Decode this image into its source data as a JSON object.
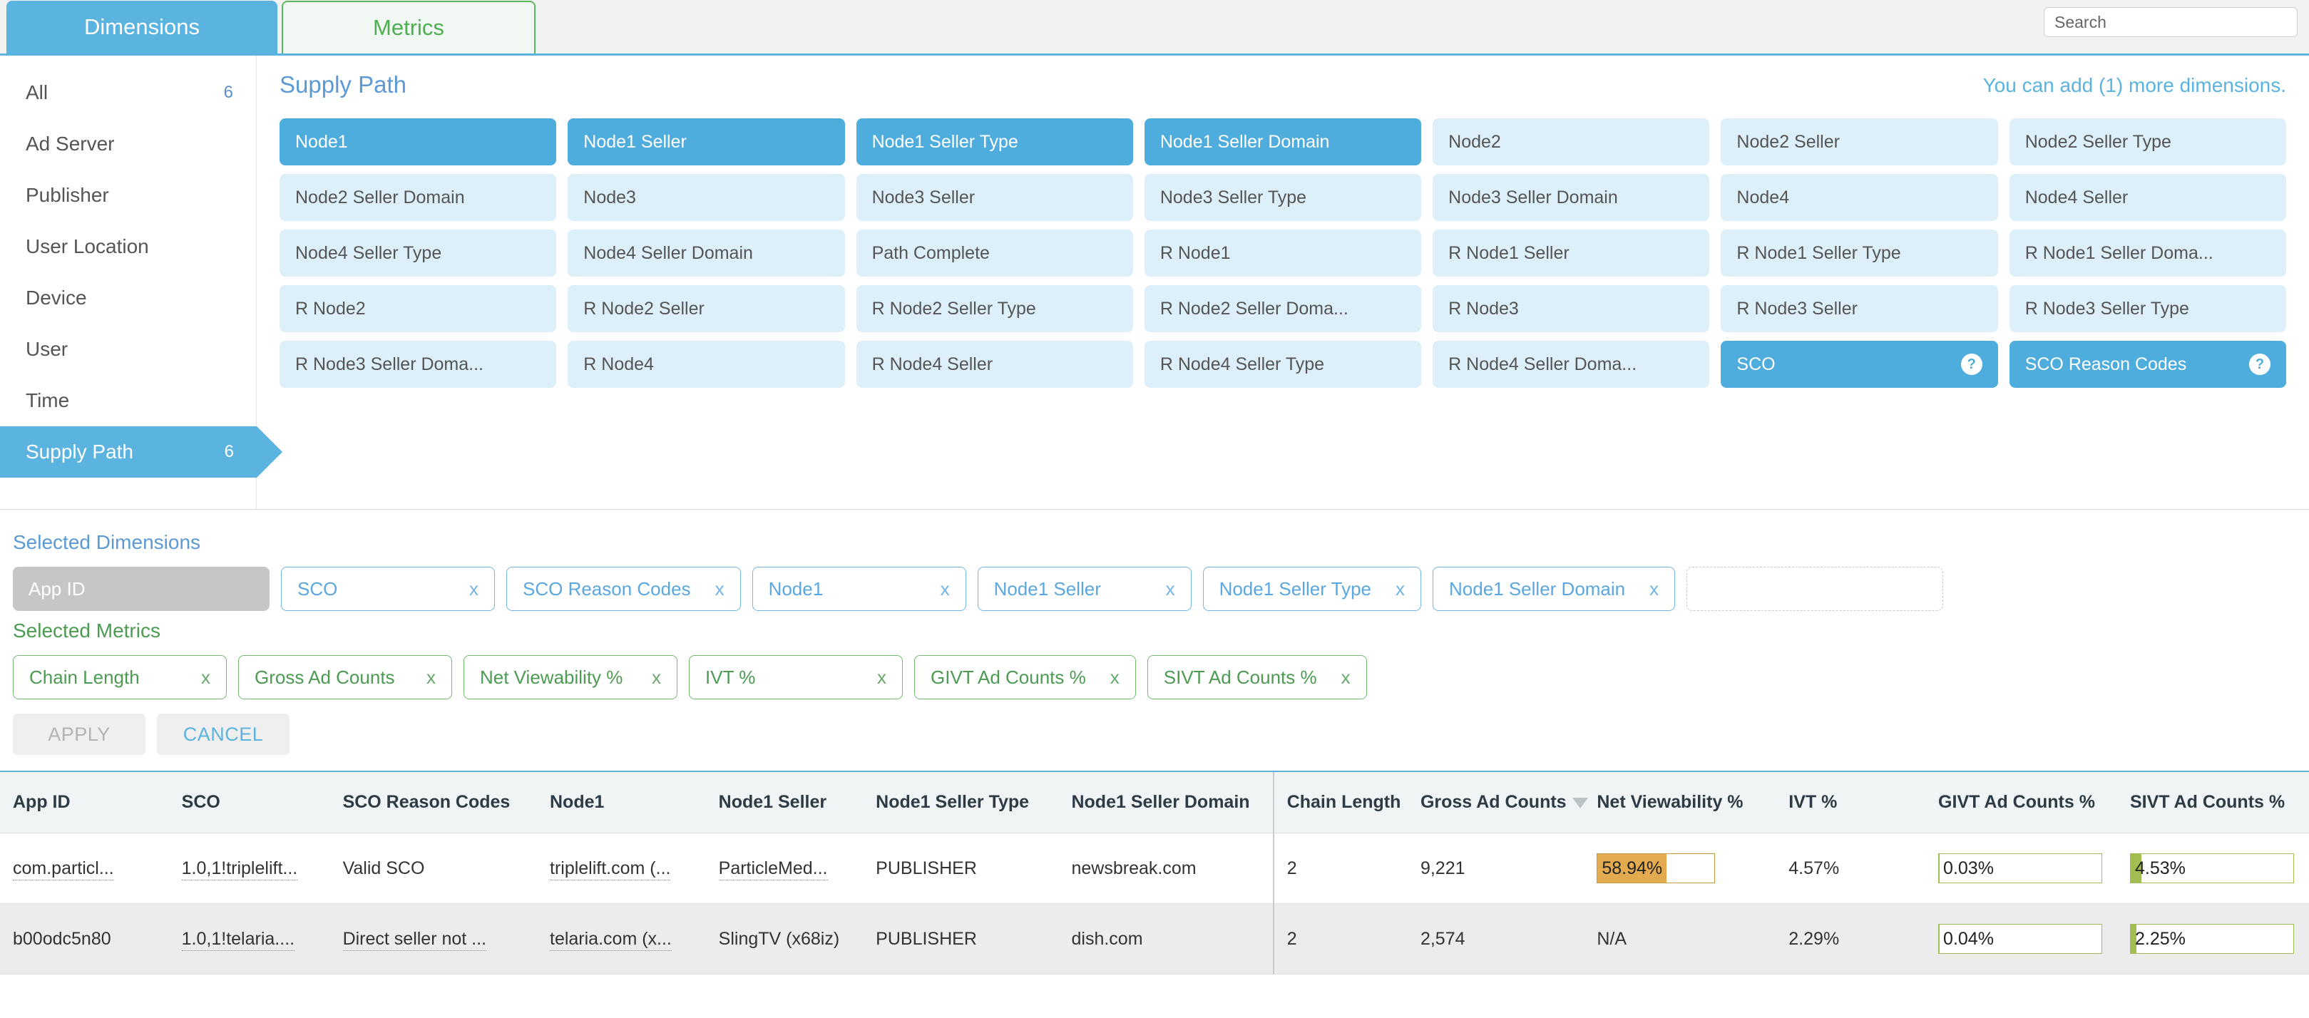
{
  "tabs": [
    {
      "label": "Dimensions",
      "active": true
    },
    {
      "label": "Metrics",
      "active": false
    }
  ],
  "search": {
    "placeholder": "Search",
    "value": ""
  },
  "sidebar": {
    "items": [
      {
        "label": "All",
        "count": "6",
        "active": false
      },
      {
        "label": "Ad Server",
        "count": "",
        "active": false
      },
      {
        "label": "Publisher",
        "count": "",
        "active": false
      },
      {
        "label": "User Location",
        "count": "",
        "active": false
      },
      {
        "label": "Device",
        "count": "",
        "active": false
      },
      {
        "label": "User",
        "count": "",
        "active": false
      },
      {
        "label": "Time",
        "count": "",
        "active": false
      },
      {
        "label": "Supply Path",
        "count": "6",
        "active": true
      }
    ]
  },
  "panel": {
    "title": "Supply Path",
    "add_note": "You can add (1) more dimensions.",
    "chips": [
      {
        "label": "Node1",
        "selected": true,
        "help": false
      },
      {
        "label": "Node1 Seller",
        "selected": true,
        "help": false
      },
      {
        "label": "Node1 Seller Type",
        "selected": true,
        "help": false
      },
      {
        "label": "Node1 Seller Domain",
        "selected": true,
        "help": false
      },
      {
        "label": "Node2",
        "selected": false,
        "help": false
      },
      {
        "label": "Node2 Seller",
        "selected": false,
        "help": false
      },
      {
        "label": "Node2 Seller Type",
        "selected": false,
        "help": false
      },
      {
        "label": "Node2 Seller Domain",
        "selected": false,
        "help": false
      },
      {
        "label": "Node3",
        "selected": false,
        "help": false
      },
      {
        "label": "Node3 Seller",
        "selected": false,
        "help": false
      },
      {
        "label": "Node3 Seller Type",
        "selected": false,
        "help": false
      },
      {
        "label": "Node3 Seller Domain",
        "selected": false,
        "help": false
      },
      {
        "label": "Node4",
        "selected": false,
        "help": false
      },
      {
        "label": "Node4 Seller",
        "selected": false,
        "help": false
      },
      {
        "label": "Node4 Seller Type",
        "selected": false,
        "help": false
      },
      {
        "label": "Node4 Seller Domain",
        "selected": false,
        "help": false
      },
      {
        "label": "Path Complete",
        "selected": false,
        "help": false
      },
      {
        "label": "R Node1",
        "selected": false,
        "help": false
      },
      {
        "label": "R Node1 Seller",
        "selected": false,
        "help": false
      },
      {
        "label": "R Node1 Seller Type",
        "selected": false,
        "help": false
      },
      {
        "label": "R Node1 Seller Doma...",
        "selected": false,
        "help": false
      },
      {
        "label": "R Node2",
        "selected": false,
        "help": false
      },
      {
        "label": "R Node2 Seller",
        "selected": false,
        "help": false
      },
      {
        "label": "R Node2 Seller Type",
        "selected": false,
        "help": false
      },
      {
        "label": "R Node2 Seller Doma...",
        "selected": false,
        "help": false
      },
      {
        "label": "R Node3",
        "selected": false,
        "help": false
      },
      {
        "label": "R Node3 Seller",
        "selected": false,
        "help": false
      },
      {
        "label": "R Node3 Seller Type",
        "selected": false,
        "help": false
      },
      {
        "label": "R Node3 Seller Doma...",
        "selected": false,
        "help": false
      },
      {
        "label": "R Node4",
        "selected": false,
        "help": false
      },
      {
        "label": "R Node4 Seller",
        "selected": false,
        "help": false
      },
      {
        "label": "R Node4 Seller Type",
        "selected": false,
        "help": false
      },
      {
        "label": "R Node4 Seller Doma...",
        "selected": false,
        "help": false
      },
      {
        "label": "SCO",
        "selected": true,
        "help": true
      },
      {
        "label": "SCO Reason Codes",
        "selected": true,
        "help": true
      }
    ]
  },
  "selected_dimensions": {
    "title": "Selected Dimensions",
    "locked": {
      "label": "App ID"
    },
    "items": [
      {
        "label": "SCO",
        "remove": "x"
      },
      {
        "label": "SCO Reason Codes",
        "remove": "x"
      },
      {
        "label": "Node1",
        "remove": "x"
      },
      {
        "label": "Node1 Seller",
        "remove": "x"
      },
      {
        "label": "Node1 Seller Type",
        "remove": "x"
      },
      {
        "label": "Node1 Seller Domain",
        "remove": "x"
      }
    ],
    "empty_slot": ""
  },
  "selected_metrics": {
    "title": "Selected Metrics",
    "items": [
      {
        "label": "Chain Length",
        "remove": "x"
      },
      {
        "label": "Gross Ad Counts",
        "remove": "x"
      },
      {
        "label": "Net Viewability %",
        "remove": "x"
      },
      {
        "label": "IVT %",
        "remove": "x"
      },
      {
        "label": "GIVT Ad Counts %",
        "remove": "x"
      },
      {
        "label": "SIVT Ad Counts %",
        "remove": "x"
      }
    ]
  },
  "actions": {
    "apply": "APPLY",
    "cancel": "CANCEL"
  },
  "table": {
    "columns": [
      {
        "label": "App ID",
        "sorted": false,
        "divider": false
      },
      {
        "label": "SCO",
        "sorted": false,
        "divider": false
      },
      {
        "label": "SCO Reason Codes",
        "sorted": false,
        "divider": false
      },
      {
        "label": "Node1",
        "sorted": false,
        "divider": false
      },
      {
        "label": "Node1 Seller",
        "sorted": false,
        "divider": false
      },
      {
        "label": "Node1 Seller Type",
        "sorted": false,
        "divider": false
      },
      {
        "label": "Node1 Seller Domain",
        "sorted": false,
        "divider": false
      },
      {
        "label": "Chain Length",
        "sorted": false,
        "divider": true
      },
      {
        "label": "Gross Ad Counts",
        "sorted": true,
        "divider": false
      },
      {
        "label": "Net Viewability %",
        "sorted": false,
        "divider": false
      },
      {
        "label": "IVT %",
        "sorted": false,
        "divider": false
      },
      {
        "label": "GIVT Ad Counts %",
        "sorted": false,
        "divider": false
      },
      {
        "label": "SIVT Ad Counts %",
        "sorted": false,
        "divider": false
      }
    ],
    "rows": [
      {
        "app_id": "com.particl...",
        "sco": "1.0,1!triplelift...",
        "sco_reason_codes": "Valid SCO",
        "node1": "triplelift.com (...",
        "node1_seller": "ParticleMed...",
        "node1_seller_type": "PUBLISHER",
        "node1_seller_domain": "newsbreak.com",
        "chain_length": "2",
        "gross_ad_counts": "9,221",
        "net_viewability": "58.94%",
        "net_viewability_pct": 58.94,
        "ivt": "4.57%",
        "givt": "0.03%",
        "givt_pct": 0.03,
        "sivt": "4.53%",
        "sivt_pct": 4.53
      },
      {
        "app_id": "b00odc5n80",
        "sco": "1.0,1!telaria....",
        "sco_reason_codes": "Direct seller not ...",
        "node1": "telaria.com (x...",
        "node1_seller": "SlingTV (x68iz)",
        "node1_seller_type": "PUBLISHER",
        "node1_seller_domain": "dish.com",
        "chain_length": "2",
        "gross_ad_counts": "2,574",
        "net_viewability": "N/A",
        "net_viewability_pct": null,
        "ivt": "2.29%",
        "givt": "0.04%",
        "givt_pct": 0.04,
        "sivt": "2.25%",
        "sivt_pct": 2.25
      }
    ]
  },
  "colors": {
    "accent_blue": "#5bb3e0",
    "metric_green": "#4d9b52",
    "bar_orange": "#e3aa4f",
    "bar_green": "#a2bd52"
  }
}
